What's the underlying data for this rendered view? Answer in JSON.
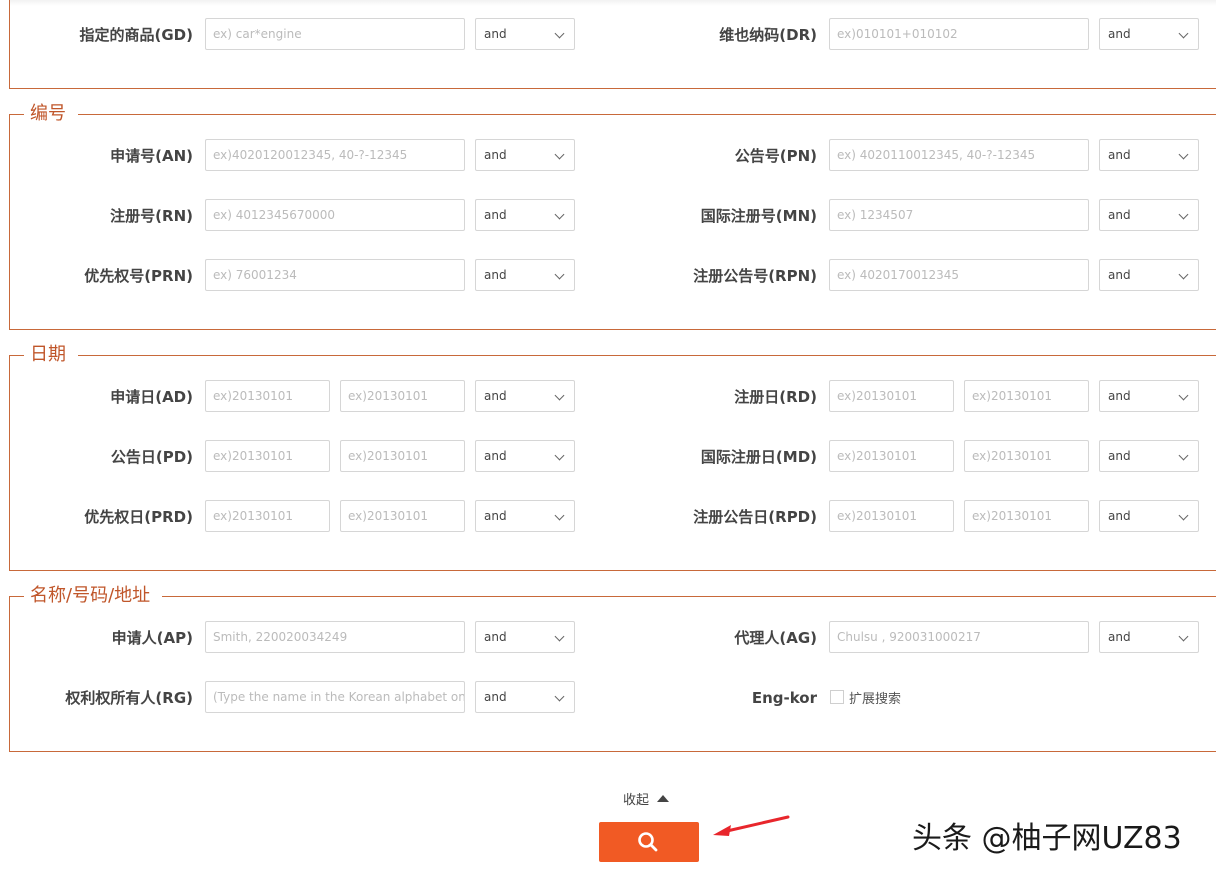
{
  "and_label": "and",
  "sections": {
    "number": "编号",
    "date": "日期",
    "name": "名称/号码/地址"
  },
  "top": {
    "gd": {
      "label": "指定的商品(GD)",
      "placeholder": "ex) car*engine"
    },
    "dr": {
      "label": "维也纳码(DR)",
      "placeholder": "ex)010101+010102"
    }
  },
  "number": {
    "an": {
      "label": "申请号(AN)",
      "placeholder": "ex)4020120012345, 40-?-12345"
    },
    "pn": {
      "label": "公告号(PN)",
      "placeholder": "ex) 4020110012345, 40-?-12345"
    },
    "rn": {
      "label": "注册号(RN)",
      "placeholder": "ex) 4012345670000"
    },
    "mn": {
      "label": "国际注册号(MN)",
      "placeholder": "ex) 1234507"
    },
    "prn": {
      "label": "优先权号(PRN)",
      "placeholder": "ex) 76001234"
    },
    "rpn": {
      "label": "注册公告号(RPN)",
      "placeholder": "ex) 4020170012345"
    }
  },
  "date": {
    "date_placeholder": "ex)20130101",
    "ad": {
      "label": "申请日(AD)"
    },
    "rd": {
      "label": "注册日(RD)"
    },
    "pd": {
      "label": "公告日(PD)"
    },
    "md": {
      "label": "国际注册日(MD)"
    },
    "prd": {
      "label": "优先权日(PRD)"
    },
    "rpd": {
      "label": "注册公告日(RPD)"
    }
  },
  "name": {
    "ap": {
      "label": "申请人(AP)",
      "placeholder": "Smith, 220020034249"
    },
    "ag": {
      "label": "代理人(AG)",
      "placeholder": "Chulsu , 920031000217"
    },
    "rg": {
      "label": "权利权所有人(RG)",
      "placeholder": "(Type the name in the Korean alphabet only)"
    },
    "engkor": {
      "label": "Eng-kor",
      "checkbox_label": "扩展搜索"
    }
  },
  "footer": {
    "collapse_label": "收起",
    "watermark": "头条 @柚子网UZ83"
  },
  "colors": {
    "accent": "#f15a24",
    "border": "#c8693a",
    "legend": "#c0562a",
    "arrow": "#e8262c"
  }
}
